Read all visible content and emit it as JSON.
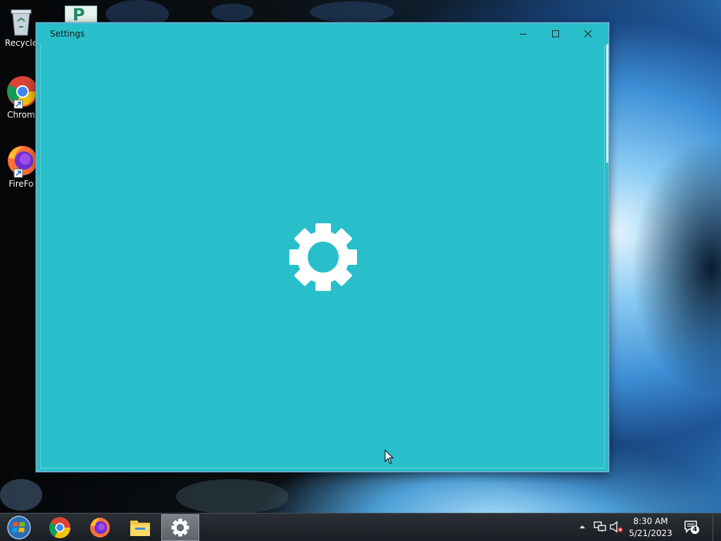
{
  "desktop": {
    "icons": [
      {
        "label": "Recycle",
        "icon": "recycle-bin-icon"
      },
      {
        "label": "Chrom",
        "icon": "chrome-icon"
      },
      {
        "label": "FireFo",
        "icon": "firefox-icon"
      }
    ],
    "partial_icon": "publisher-icon"
  },
  "window": {
    "title": "Settings",
    "background_color": "#28bfcb",
    "controls": [
      "minimize-icon",
      "maximize-icon",
      "close-icon"
    ],
    "content_icon": "gear-icon"
  },
  "taskbar": {
    "start": "windows-start-icon",
    "pinned": [
      "chrome-icon",
      "firefox-icon",
      "file-explorer-icon",
      "settings-gear-icon"
    ],
    "active_app": "settings",
    "tray": [
      "show-hidden-icons-chevron",
      "network-icon",
      "volume-muted-icon"
    ],
    "clock": {
      "time": "8:30 AM",
      "date": "5/21/2023"
    },
    "notifications": {
      "count": "4",
      "icon": "action-center-icon"
    }
  }
}
